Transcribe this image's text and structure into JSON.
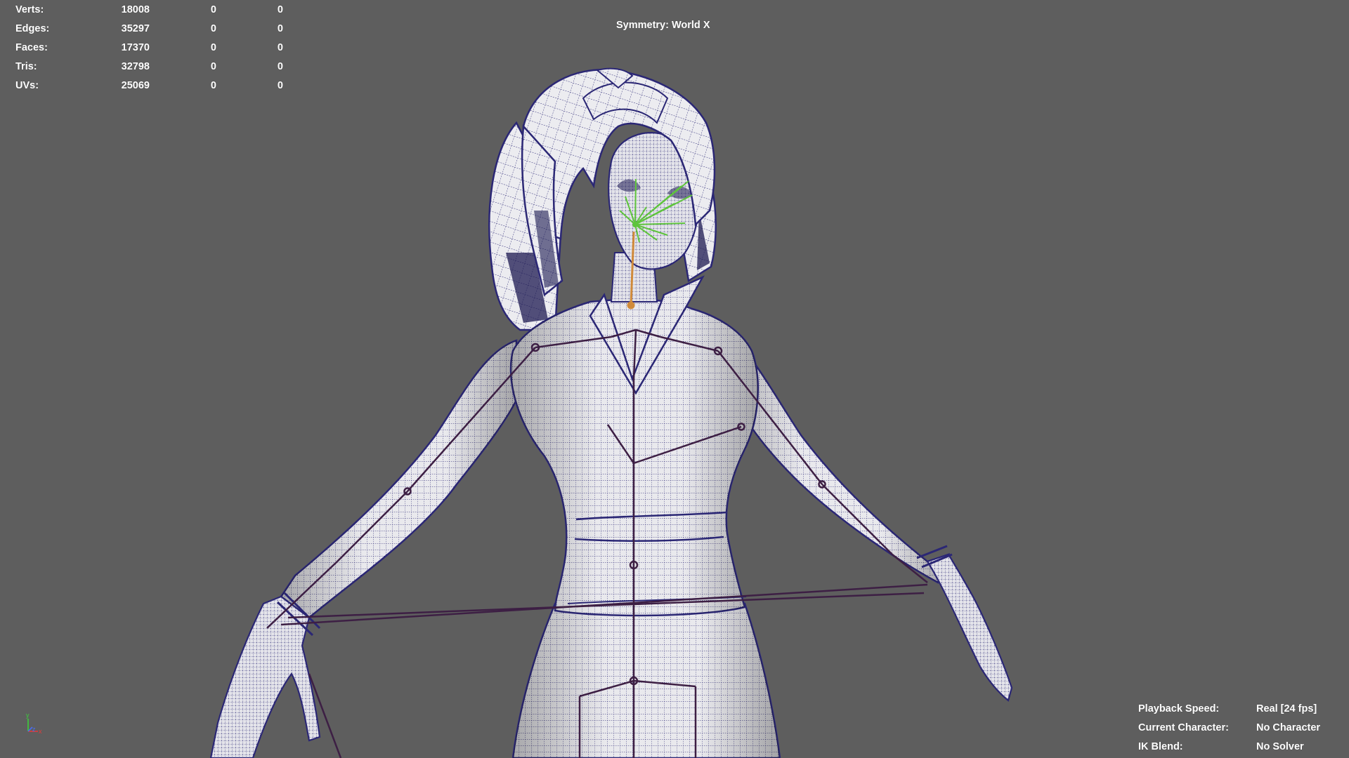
{
  "viewport": {
    "background": "#5e5e5e",
    "mesh_wire_color": "#2b2775",
    "mesh_fill_color": "#e8e8ec",
    "joint_color": "#3d1f44",
    "selected_joint_color": "#d08a3a",
    "face_rig_color": "#5ec43c"
  },
  "poly_count": {
    "rows": [
      {
        "label": "Verts:",
        "total": "18008",
        "selected": "0",
        "component": "0"
      },
      {
        "label": "Edges:",
        "total": "35297",
        "selected": "0",
        "component": "0"
      },
      {
        "label": "Faces:",
        "total": "17370",
        "selected": "0",
        "component": "0"
      },
      {
        "label": "Tris:",
        "total": "32798",
        "selected": "0",
        "component": "0"
      },
      {
        "label": "UVs:",
        "total": "25069",
        "selected": "0",
        "component": "0"
      }
    ]
  },
  "symmetry": {
    "text": "Symmetry: World X"
  },
  "playback_hud": {
    "rows": [
      {
        "label": "Playback Speed:",
        "value": "Real [24 fps]"
      },
      {
        "label": "Current Character:",
        "value": "No Character"
      },
      {
        "label": "IK Blend:",
        "value": "No Solver"
      }
    ]
  },
  "axis_gizmo": {
    "icon": "view-axis-icon",
    "axes": {
      "y": "y",
      "z": "z",
      "x": "x"
    },
    "colors": {
      "x": "#e23a3a",
      "y": "#3ccf3c",
      "z": "#4a6cf0"
    }
  }
}
